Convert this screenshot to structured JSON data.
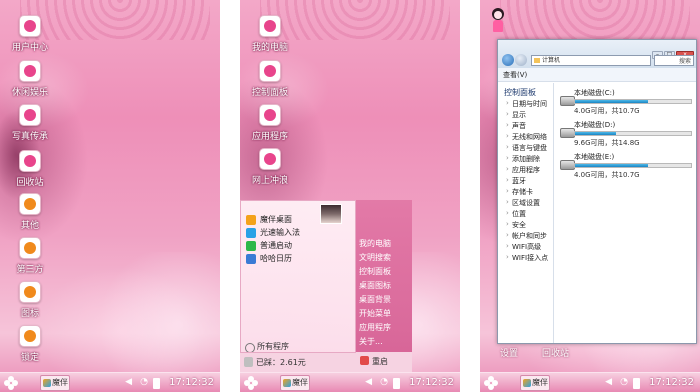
{
  "taskbar": {
    "app_label": "魔伴",
    "time": "17:12:32"
  },
  "screen1": {
    "icons": [
      {
        "label": "用户中心",
        "color": "#e8458c"
      },
      {
        "label": "休闲娱乐",
        "color": "#e8458c"
      },
      {
        "label": "写真传承",
        "color": "#e8458c"
      },
      {
        "label": "回收站",
        "color": "#e8458c"
      },
      {
        "label": "其他",
        "color": "#f08a1c"
      },
      {
        "label": "第三方",
        "color": "#f08a1c"
      },
      {
        "label": "图标",
        "color": "#f08a1c"
      },
      {
        "label": "锁定",
        "color": "#f08a1c"
      }
    ]
  },
  "screen2": {
    "icons": [
      {
        "label": "我的电脑",
        "color": "#e8458c"
      },
      {
        "label": "控制面板",
        "color": "#e8458c"
      },
      {
        "label": "应用程序",
        "color": "#e8458c"
      },
      {
        "label": "网上冲浪",
        "color": "#e8458c"
      }
    ],
    "start_menu": {
      "items": [
        {
          "label": "魔伴桌面",
          "color": "#f4a21b"
        },
        {
          "label": "光速输入法",
          "color": "#2aa1e6"
        },
        {
          "label": "普通启动",
          "color": "#2db84a"
        },
        {
          "label": "哈哈日历",
          "color": "#3a7bd5"
        }
      ],
      "all_programs": "所有程序",
      "right_items": [
        "我的电脑",
        "文明搜索",
        "控制面板",
        "桌面图标",
        "桌面背景",
        "开始菜单",
        "应用程序",
        "关于..."
      ],
      "used": "已踩：2.61元",
      "restart": "重启"
    }
  },
  "screen3": {
    "behind_labels": [
      "设置",
      "回收站"
    ],
    "explorer": {
      "address": "计算机",
      "search": "搜索",
      "view_label": "查看(V)",
      "side_head": "控制面板",
      "side_items": [
        "日期与时间",
        "显示",
        "声音",
        "无线和网络",
        "语言与键盘",
        "添加删除",
        "应用程序",
        "蓝牙",
        "存储卡",
        "区域设置",
        "位置",
        "安全",
        "帐户和同步",
        "WIFI高级",
        "WIFI接入点"
      ],
      "disks": [
        {
          "name": "本地磁盘(C:)",
          "free": "4.0G可用，共10.7G",
          "used_fraction": 0.63
        },
        {
          "name": "本地磁盘(D:)",
          "free": "9.6G可用，共14.8G",
          "used_fraction": 0.35
        },
        {
          "name": "本地磁盘(E:)",
          "free": "4.0G可用，共10.7G",
          "used_fraction": 0.63
        }
      ]
    }
  }
}
